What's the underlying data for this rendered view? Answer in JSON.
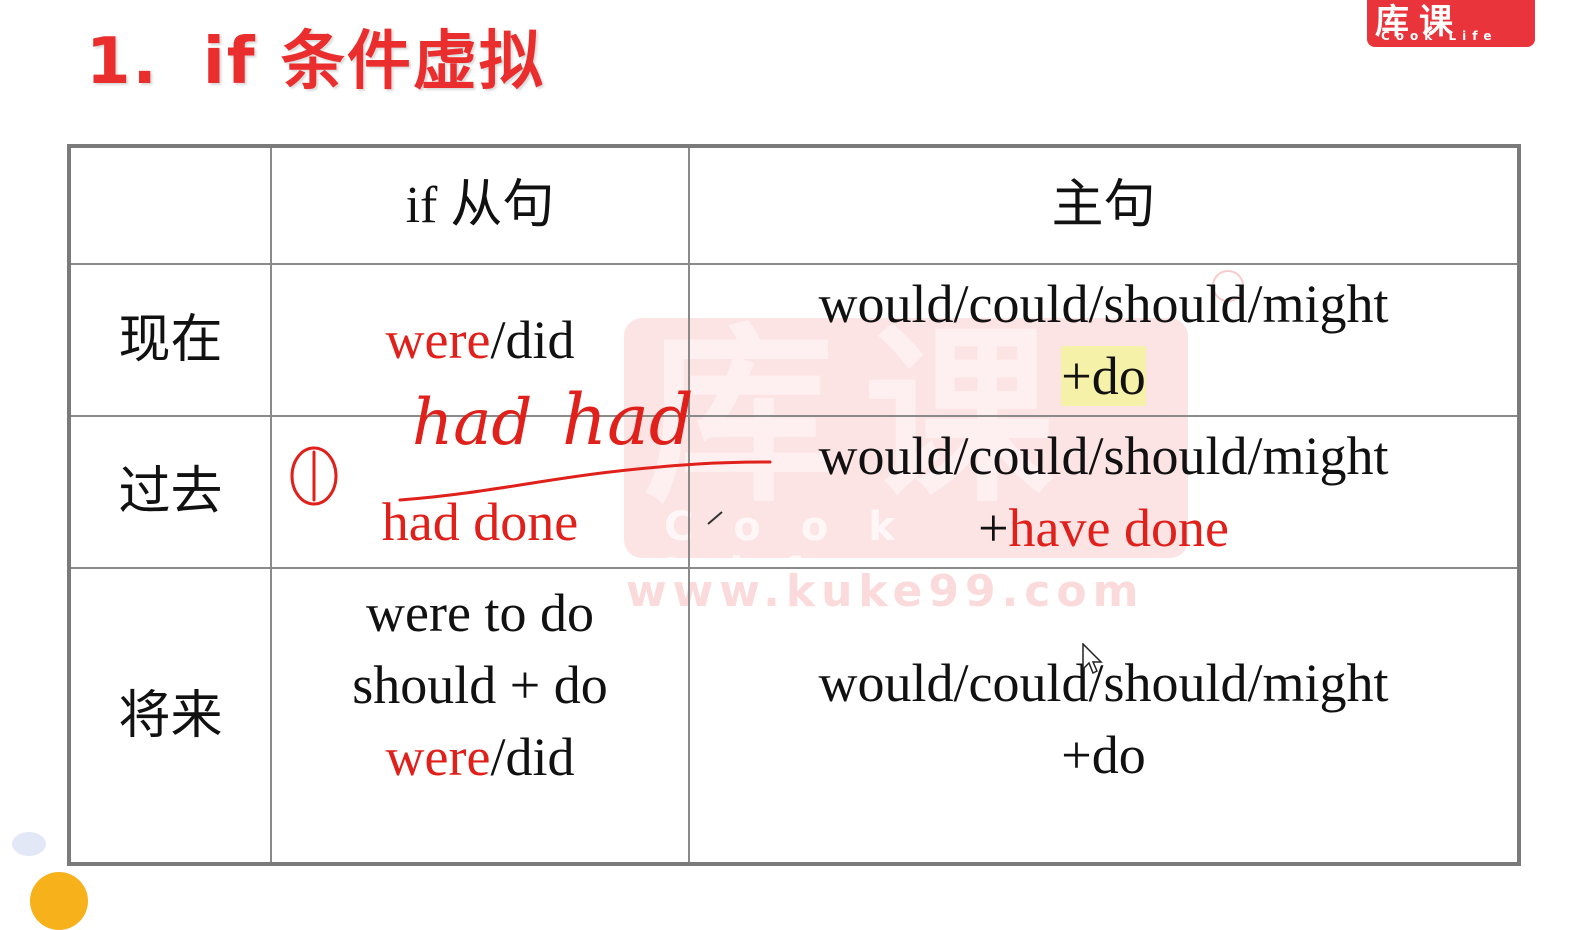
{
  "slide": {
    "title_number": "1.",
    "title_text": "if 条件虚拟",
    "logo_glyphs": "库课",
    "logo_sub": "Cook Life",
    "watermark_glyphs": "库课",
    "watermark_sub": "Cook Life",
    "watermark_url": "www.kuke99.com"
  },
  "table": {
    "headers": [
      "",
      "if 从句",
      "主句"
    ],
    "rows": [
      {
        "label": "现在",
        "if_lines": [
          [
            "were",
            "/did"
          ]
        ],
        "main_lines": [
          "would/could/should/might",
          "+do"
        ]
      },
      {
        "label": "过去",
        "if_lines": [
          [
            "had done"
          ]
        ],
        "main_lines": [
          "would/could/should/might",
          "+",
          "have done"
        ]
      },
      {
        "label": "将来",
        "if_lines": [
          [
            "were to do"
          ],
          [
            "should + do"
          ],
          [
            "were",
            "/did"
          ]
        ],
        "main_lines": [
          "would/could/should/might",
          "+do"
        ]
      }
    ]
  },
  "annotations": {
    "circled_number": "①",
    "handwriting": [
      "had",
      "had"
    ],
    "ink_color": "#e0201b"
  }
}
